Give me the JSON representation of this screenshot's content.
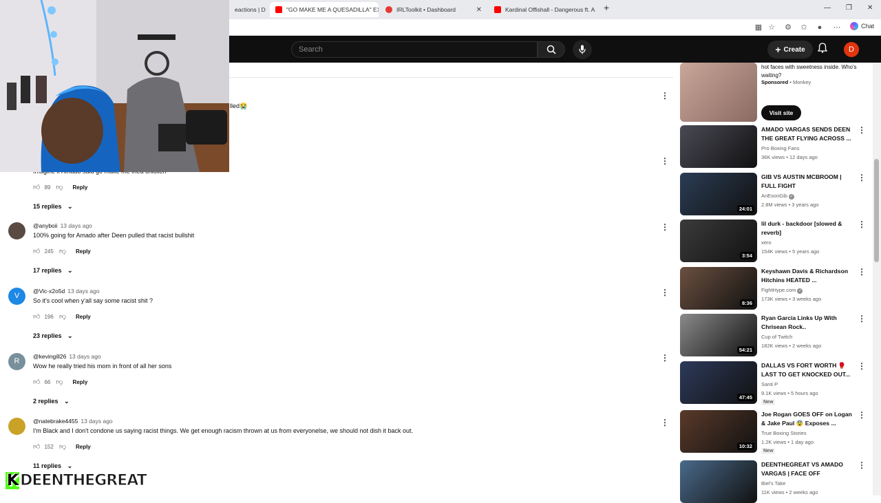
{
  "browser": {
    "tabs": [
      {
        "label": "eactions | D"
      },
      {
        "label": "\"GO MAKE ME A QUESADILLA\" EX"
      },
      {
        "label": "IRLToolkit • Dashboard"
      },
      {
        "label": "Kardinal Offishall - Dangerous ft. A"
      }
    ],
    "chat_label": "Chat"
  },
  "youtube": {
    "search_placeholder": "Search",
    "create_label": "Create",
    "avatar_letter": "D"
  },
  "comments": {
    "partial_text": "lled😭",
    "first": {
      "text": "Imagine if Amado said go make me fried chicken",
      "likes": "89",
      "reply_label": "Reply",
      "replies_label": "15 replies"
    },
    "items": [
      {
        "author": "@anyboii",
        "time": "13 days ago",
        "text": "100% going for Amado after Deen pulled that racist bullshit",
        "likes": "245",
        "reply_label": "Reply",
        "replies_label": "17 replies",
        "avatar_letter": "",
        "avatar_color": "#5a4a42"
      },
      {
        "author": "@Vic-x2o5d",
        "time": "13 days ago",
        "text": "So it's cool when y'all say some racist shit ?",
        "likes": "196",
        "reply_label": "Reply",
        "replies_label": "23 replies",
        "avatar_letter": "V",
        "avatar_color": "#1e88e5"
      },
      {
        "author": "@kevingill26",
        "time": "13 days ago",
        "text": "Wow he really tried his mom in front of all her sons",
        "likes": "66",
        "reply_label": "Reply",
        "replies_label": "2 replies",
        "avatar_letter": "R",
        "avatar_color": "#78909c"
      },
      {
        "author": "@natebrake4455",
        "time": "13 days ago",
        "text": "I'm Black and I don't condone us saying racist things. We get enough racism thrown at us from everyonelse, we should not dish it back out.",
        "likes": "152",
        "reply_label": "Reply",
        "replies_label": "11 replies",
        "avatar_letter": "",
        "avatar_color": "#c9a227"
      }
    ]
  },
  "sidebar": {
    "ad": {
      "text": "hot faces with sweetness inside. Who's waiting?",
      "sponsored": "Sponsored",
      "advertiser": "Monkey",
      "cta": "Visit site"
    },
    "videos": [
      {
        "title": "AMADO VARGAS SENDS DEEN THE GREAT FLYING ACROSS ...",
        "channel": "Pro Boxing Fans",
        "meta": "36K views • 12 days ago",
        "duration": "",
        "verified": false,
        "is_new": false,
        "thumb_color": "#4a4a55"
      },
      {
        "title": "GIB VS AUSTIN MCBROOM | FULL FIGHT",
        "channel": "AnEsonGib",
        "meta": "2.8M views • 3 years ago",
        "duration": "24:01",
        "verified": true,
        "is_new": false,
        "thumb_color": "#2b3d55"
      },
      {
        "title": "lil durk - backdoor [slowed & reverb]",
        "channel": "xero",
        "meta": "154K views • 5 years ago",
        "duration": "3:54",
        "verified": false,
        "is_new": false,
        "thumb_color": "#3b3b3b"
      },
      {
        "title": "Keyshawn Davis & Richardson Hitchins HEATED ...",
        "channel": "FightHype.com",
        "meta": "173K views • 3 weeks ago",
        "duration": "8:36",
        "verified": true,
        "is_new": false,
        "thumb_color": "#6b5040"
      },
      {
        "title": "Ryan Garcia Links Up With Chrisean Rock..",
        "channel": "Cup of Twitch",
        "meta": "182K views • 2 weeks ago",
        "duration": "54:21",
        "verified": false,
        "is_new": false,
        "thumb_color": "#8a8a8a"
      },
      {
        "title": "DALLAS VS FORT WORTH 🥊 LAST TO GET KNOCKED OUT...",
        "channel": "Santi P",
        "meta": "9.1K views • 5 hours ago",
        "duration": "47:45",
        "verified": false,
        "is_new": true,
        "thumb_color": "#2d3a5a"
      },
      {
        "title": "Joe Rogan GOES OFF on Logan & Jake Paul 😨 Exposes ...",
        "channel": "True Boxing Stories",
        "meta": "1.2K views • 1 day ago",
        "duration": "10:32",
        "verified": false,
        "is_new": true,
        "thumb_color": "#5a3a2a"
      },
      {
        "title": "DEENTHEGREAT VS AMADO VARGAS | FACE OFF",
        "channel": "Biel's Take",
        "meta": "11K views • 2 weeks ago",
        "duration": "",
        "verified": false,
        "is_new": false,
        "thumb_color": "#4a6a8a"
      }
    ],
    "new_badge": "New"
  },
  "overlay": {
    "watermark": "DEENTHEGREAT",
    "kick_letter": "K",
    "cap_text": "DEENTHEGREAT"
  },
  "colors": {
    "yt_red": "#ff0000",
    "kick_green": "#53fc18",
    "header_bg": "#0f0f0f"
  }
}
